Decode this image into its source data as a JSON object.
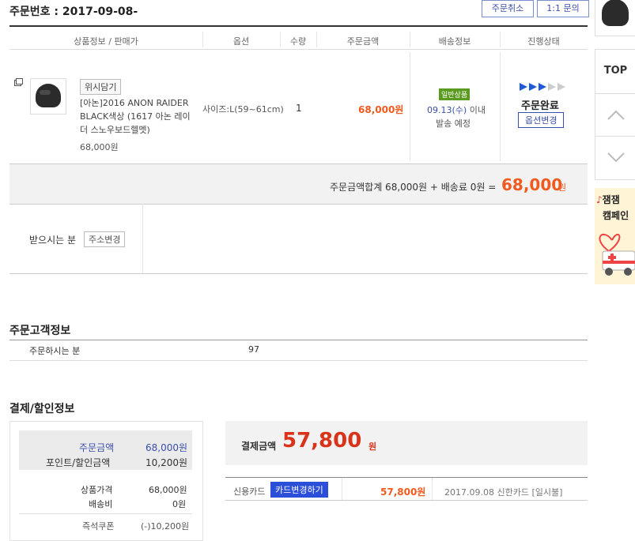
{
  "order": {
    "number_label": "주문번호 : 2017-09-08-",
    "cancel_button": "주문취소",
    "inquiry_button": "1:1 문의"
  },
  "table": {
    "headers": [
      "상품정보 / 판매가",
      "옵션",
      "수량",
      "주문금액",
      "배송정보",
      "진행상태"
    ]
  },
  "item": {
    "wish_button": "위시담기",
    "name": "[아논]2016 ANON RAIDER BLACK색상 (1617 아논 레이더 스노우보드헬멧)",
    "price": "68,000원",
    "option": "사이즈:L(59~61cm)",
    "qty": "1",
    "order_amount": "68,000원",
    "ship_badge": "일반상품",
    "ship_date": "09.13(수)",
    "ship_within": " 이내",
    "ship_note": "발송 예정",
    "status": "주문완료",
    "status_button": "옵션변경",
    "progress_steps": 5,
    "progress_done": 3
  },
  "summary": {
    "text": "주문금액합계 68,000원 + 배송료 0원 =",
    "total": "68,000",
    "unit": "원"
  },
  "receiver": {
    "label": "받으시는 분",
    "change_button": "주소변경"
  },
  "customer": {
    "title": "주문고객정보",
    "orderer_label": "주문하시는 분",
    "orderer_value": "97"
  },
  "payment": {
    "title": "결제/할인정보",
    "order_amount_label": "주문금액",
    "order_amount_value": "68,000원",
    "discount_label": "포인트/할인금액",
    "discount_value": "10,200원",
    "product_price_label": "상품가격",
    "product_price_value": "68,000원",
    "shipping_label": "배송비",
    "shipping_value": "0원",
    "coupon_label": "즉석쿠폰",
    "coupon_value": "(-)10,200원",
    "pay_label": "결제금액",
    "pay_value": "57,800",
    "pay_unit": "원",
    "method_label": "신용카드",
    "card_change_button": "카드변경하기",
    "method_amount": "57,800원",
    "method_detail": "2017.09.08 신한카드 [일시불]"
  },
  "rail": {
    "top_label": "TOP",
    "banner_line1": "잼잼",
    "banner_line2": "캠페인"
  },
  "colors": {
    "accent_blue": "#3a4fa8",
    "accent_orange": "#f05a1e",
    "badge_green": "#5a9a1f"
  }
}
